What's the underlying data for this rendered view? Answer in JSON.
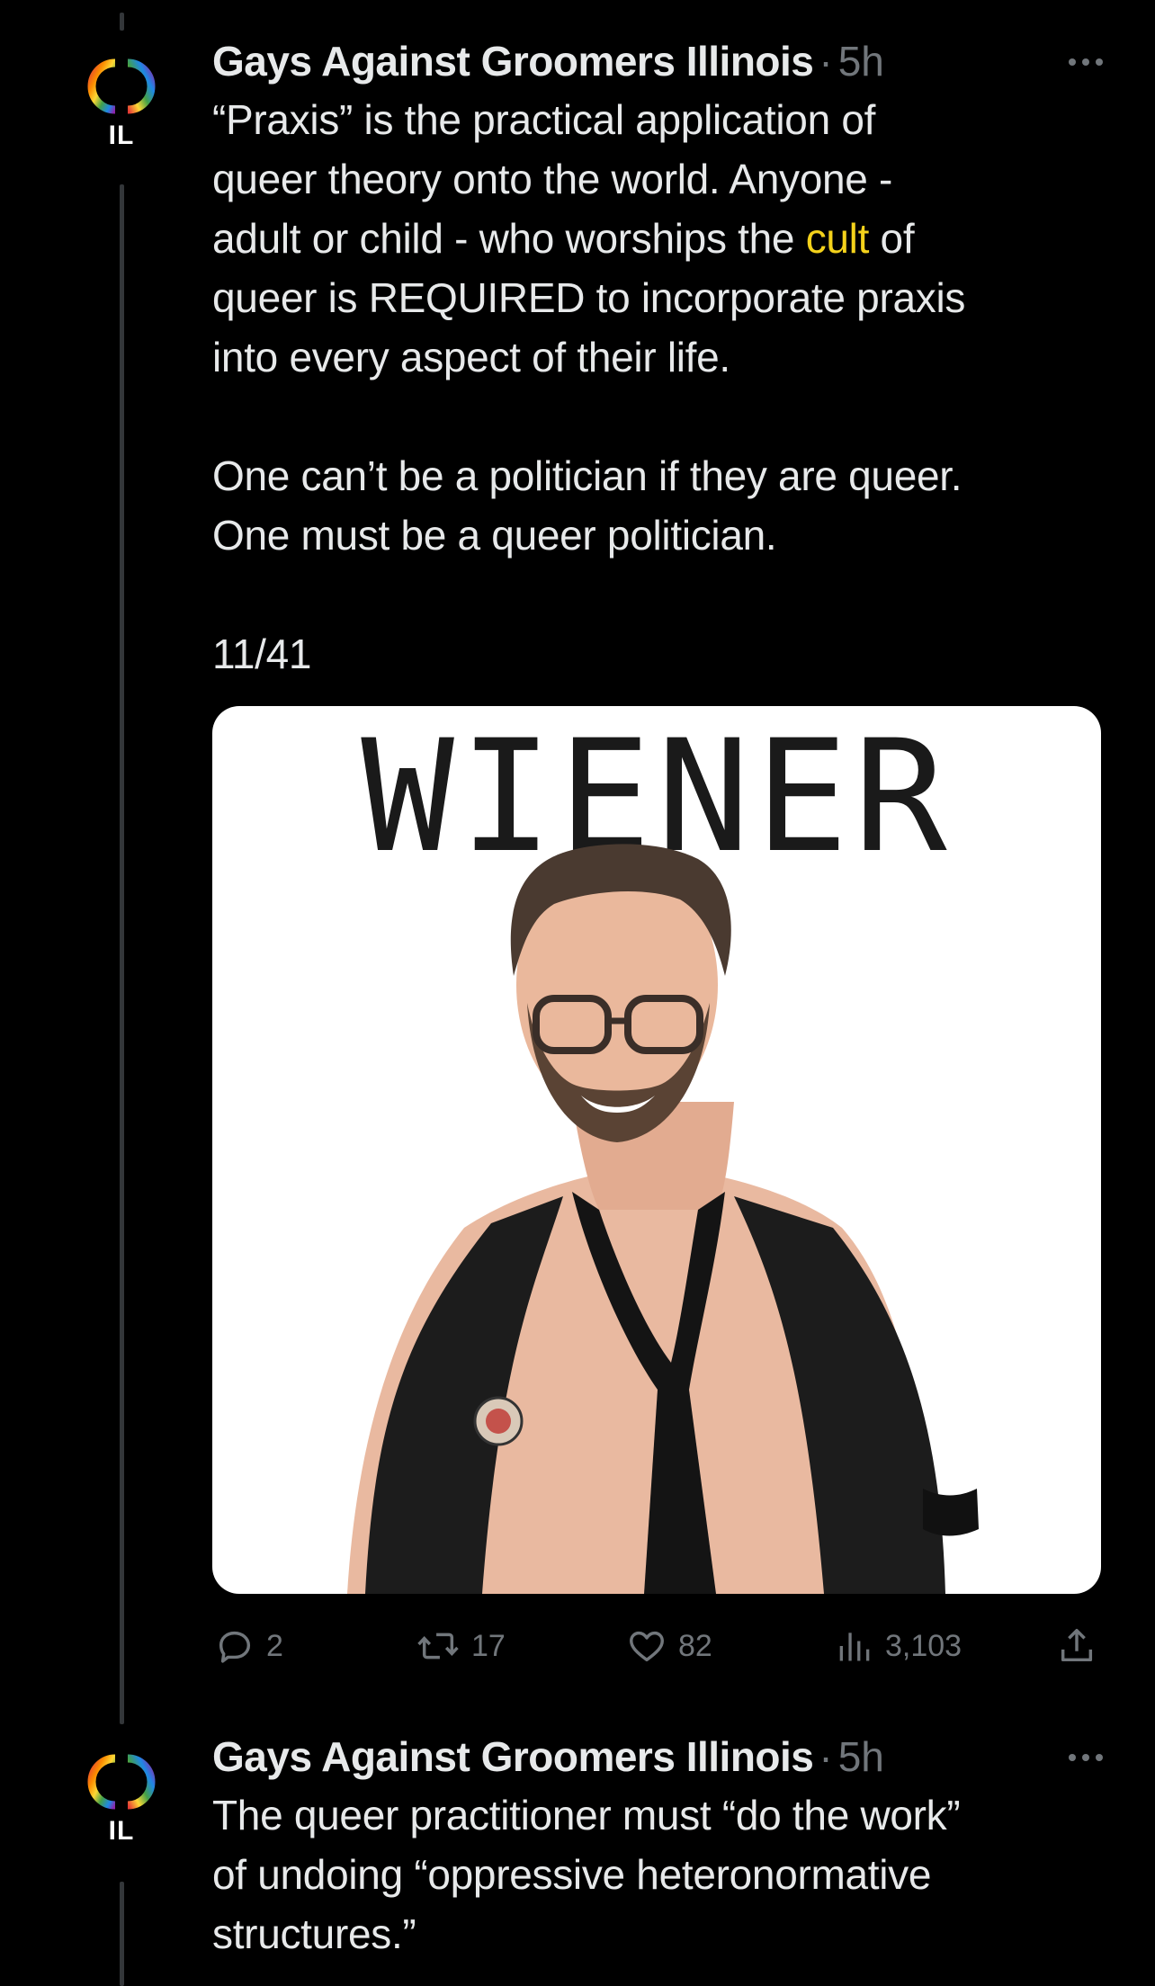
{
  "tweets": [
    {
      "author": "Gays Against Groomers Illinois",
      "separator": "·",
      "time": "5h",
      "avatar_label": "IL",
      "text_lines": [
        "“Praxis” is the practical application of",
        "queer theory onto the world. Anyone -",
        "adult or child - who worships the ",
        "cult",
        " of",
        "queer is REQUIRED to incorporate praxis",
        "into every aspect of their life.",
        "One can’t be a politician if they are queer.",
        "One must be a queer politician.",
        "11/41"
      ],
      "media": {
        "caption": "WIENER",
        "description_icon": "photo-person"
      },
      "actions": {
        "replies": "2",
        "reposts": "17",
        "likes": "82",
        "views": "3,103"
      }
    },
    {
      "author": "Gays Against Groomers Illinois",
      "separator": "·",
      "time": "5h",
      "avatar_label": "IL",
      "text_lines": [
        "The queer practitioner must “do the work”",
        "of undoing “oppressive heteronormative",
        "structures.”"
      ]
    }
  ],
  "colors": {
    "background": "#000000",
    "text": "#e7e9ea",
    "muted": "#71767b",
    "highlight": "#f4d21b",
    "thread_line": "#333639"
  }
}
